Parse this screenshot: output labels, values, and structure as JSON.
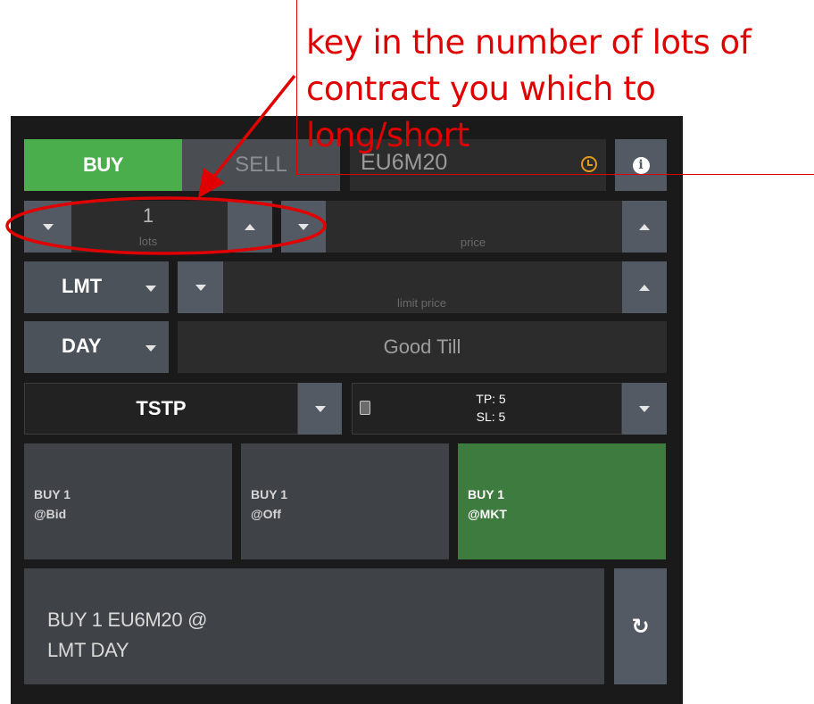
{
  "annotation": {
    "line1": "key in the number of lots of",
    "line2": "contract you which to",
    "line3": "long/short",
    "color": "#e00000"
  },
  "order_panel": {
    "side_buy_label": "BUY",
    "side_sell_label": "SELL",
    "symbol": "EU6M20",
    "lots_value": "1",
    "lots_label": "lots",
    "price_label": "price",
    "order_type": "LMT",
    "limit_price_label": "limit price",
    "duration": "DAY",
    "good_till_label": "Good Till",
    "bracket_type": "TSTP",
    "tp_label": "TP: 5",
    "sl_label": "SL: 5",
    "actions": [
      {
        "line1": "BUY 1",
        "line2": "@Bid"
      },
      {
        "line1": "BUY 1",
        "line2": "@Off"
      },
      {
        "line1": "BUY 1",
        "line2": "@MKT"
      }
    ],
    "summary_line1": "BUY 1 EU6M20 @",
    "summary_line2": "LMT DAY",
    "colors": {
      "buy_green": "#4aae4c",
      "mkt_green": "#3d7b3f",
      "panel_bg": "#1a1a1a",
      "clock_orange": "#e09a1c"
    }
  }
}
